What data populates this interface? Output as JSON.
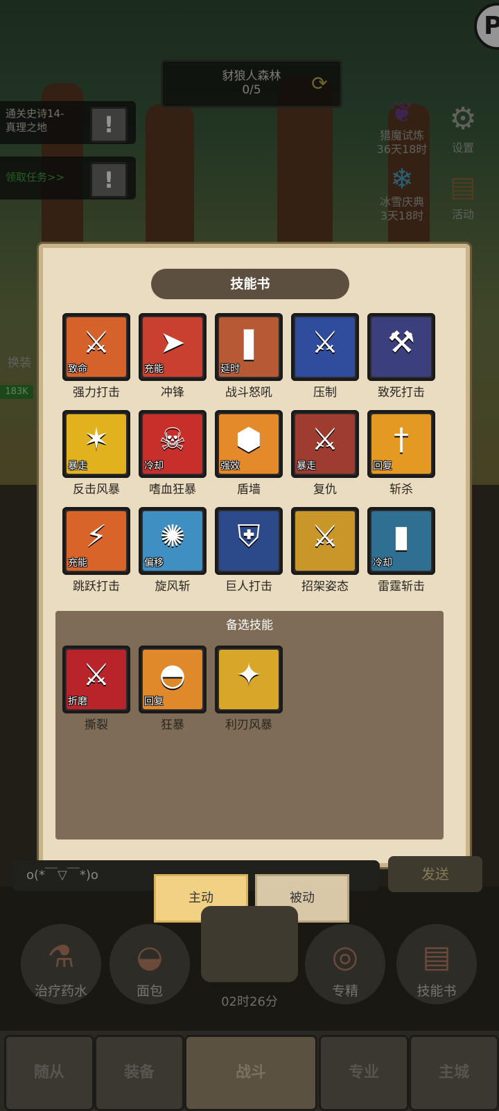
{
  "hud": {
    "stage_name": "豺狼人森林",
    "stage_progress": "0/5",
    "quest1": "通关史诗14-\n真理之地",
    "quest2": "领取任务>>",
    "event1_name": "猎魔试炼",
    "event1_time": "36天18时",
    "event2_name": "冰雪庆典",
    "event2_time": "3天18时",
    "settings": "设置",
    "activity": "活动",
    "left_label": "换装",
    "left_power": "183K"
  },
  "modal": {
    "title": "技能书",
    "skills": [
      {
        "name": "强力打击",
        "tag": "致命",
        "color": "#d4622a",
        "icon": "sword-icon",
        "glyph": "⚔"
      },
      {
        "name": "冲锋",
        "tag": "充能",
        "color": "#c9412e",
        "icon": "arrow-icon",
        "glyph": "➤"
      },
      {
        "name": "战斗怒吼",
        "tag": "延时",
        "color": "#b55a34",
        "icon": "shout-icon",
        "glyph": "❚"
      },
      {
        "name": "压制",
        "tag": "",
        "color": "#2f4d9c",
        "icon": "blade-icon",
        "glyph": "⚔"
      },
      {
        "name": "致死打击",
        "tag": "",
        "color": "#3b3f7c",
        "icon": "axe-icon",
        "glyph": "⚒"
      },
      {
        "name": "反击风暴",
        "tag": "暴走",
        "color": "#e2b21e",
        "icon": "claw-icon",
        "glyph": "✶"
      },
      {
        "name": "嗜血狂暴",
        "tag": "冷却",
        "color": "#c72f2a",
        "icon": "skull-icon",
        "glyph": "☠"
      },
      {
        "name": "盾墙",
        "tag": "强效",
        "color": "#e58a2a",
        "icon": "shield-icon",
        "glyph": "⬢"
      },
      {
        "name": "复仇",
        "tag": "暴走",
        "color": "#9e3d2f",
        "icon": "sword-icon",
        "glyph": "⚔"
      },
      {
        "name": "斩杀",
        "tag": "回复",
        "color": "#e49a22",
        "icon": "dagger-icon",
        "glyph": "†"
      },
      {
        "name": "跳跃打击",
        "tag": "充能",
        "color": "#d9642a",
        "icon": "crack-icon",
        "glyph": "⚡"
      },
      {
        "name": "旋风斩",
        "tag": "偏移",
        "color": "#3f8fc2",
        "icon": "whirlwind-icon",
        "glyph": "✺"
      },
      {
        "name": "巨人打击",
        "tag": "",
        "color": "#2c4a8a",
        "icon": "shield-crack-icon",
        "glyph": "⛨"
      },
      {
        "name": "招架姿态",
        "tag": "",
        "color": "#c9962a",
        "icon": "serrated-sword-icon",
        "glyph": "⚔"
      },
      {
        "name": "雷霆斩击",
        "tag": "冷却",
        "color": "#2e6f92",
        "icon": "lightning-icon",
        "glyph": "▮"
      }
    ],
    "alt_title": "备选技能",
    "alt_skills": [
      {
        "name": "撕裂",
        "tag": "折磨",
        "color": "#b8242a",
        "icon": "rend-icon",
        "glyph": "⚔"
      },
      {
        "name": "狂暴",
        "tag": "回复",
        "color": "#e0892a",
        "icon": "hood-icon",
        "glyph": "◓"
      },
      {
        "name": "利刃风暴",
        "tag": "",
        "color": "#d8a72a",
        "icon": "bladestorm-icon",
        "glyph": "✦"
      }
    ]
  },
  "tabs": {
    "active": "主动",
    "passive": "被动"
  },
  "chat": {
    "text": "o(*￣▽￣*)o",
    "send": "发送"
  },
  "actions": [
    {
      "label": "治疗药水",
      "icon": "potion-icon",
      "glyph": "⚗"
    },
    {
      "label": "面包",
      "icon": "bread-icon",
      "glyph": "◒"
    },
    {
      "label": "专精",
      "icon": "mastery-icon",
      "glyph": "◎"
    },
    {
      "label": "技能书",
      "icon": "book-icon",
      "glyph": "▤"
    }
  ],
  "timer": "02时26分",
  "nav": [
    "随从",
    "装备",
    "战斗",
    "专业",
    "主城"
  ]
}
